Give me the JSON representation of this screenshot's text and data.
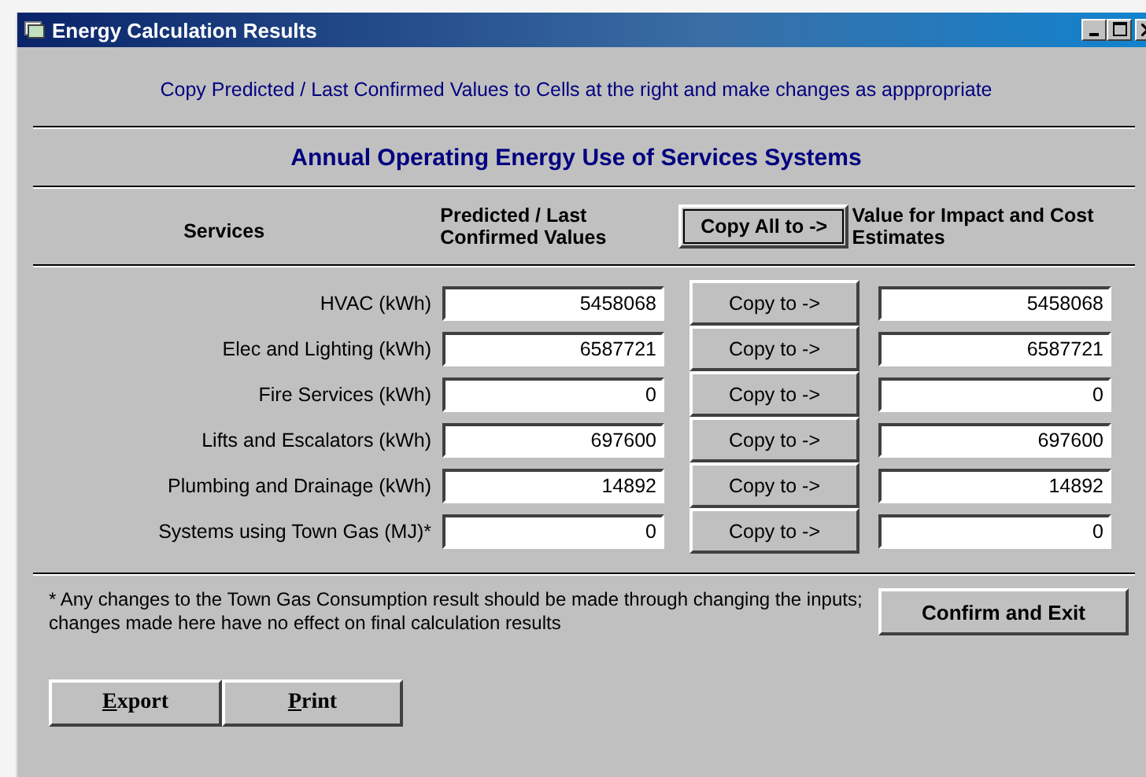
{
  "window": {
    "title": "Energy Calculation Results"
  },
  "instruction": "Copy Predicted / Last Confirmed Values to Cells at the right and make changes as apppropriate",
  "heading": "Annual Operating Energy Use of Services Systems",
  "columns": [
    "Services",
    "Predicted / Last Confirmed Values",
    "Value for Impact and Cost Estimates"
  ],
  "copy_all_button": "Copy All to ->",
  "rows": [
    {
      "label": "HVAC (kWh)",
      "predicted": "5458068",
      "copy_button": "Copy to ->",
      "value": "5458068"
    },
    {
      "label": "Elec and Lighting (kWh)",
      "predicted": "6587721",
      "copy_button": "Copy to ->",
      "value": "6587721"
    },
    {
      "label": "Fire Services (kWh)",
      "predicted": "0",
      "copy_button": "Copy to ->",
      "value": "0"
    },
    {
      "label": "Lifts and Escalators (kWh)",
      "predicted": "697600",
      "copy_button": "Copy to ->",
      "value": "697600"
    },
    {
      "label": "Plumbing and Drainage (kWh)",
      "predicted": "14892",
      "copy_button": "Copy to ->",
      "value": "14892"
    },
    {
      "label": "Systems using Town Gas (MJ)*",
      "predicted": "0",
      "copy_button": "Copy to ->",
      "value": "0"
    }
  ],
  "note": "* Any changes to the Town Gas Consumption result should be made through changing the inputs; changes made here have no effect on final calculation results",
  "confirm_button": "Confirm and Exit",
  "buttons": [
    "Export",
    "Print"
  ]
}
